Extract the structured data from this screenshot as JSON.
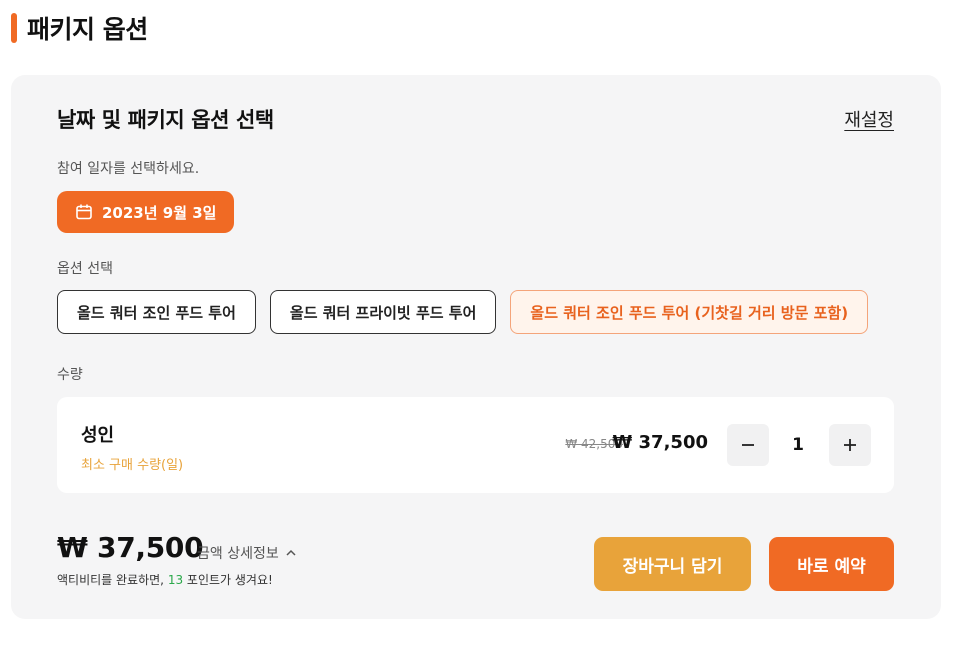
{
  "header": {
    "title": "패키지 옵션",
    "accent_color": "#f06a24"
  },
  "panel": {
    "title": "날짜 및 패키지 옵션 선택",
    "reset_label": "재설정",
    "date_prompt": "참여 일자를 선택하세요.",
    "date_value": "2023년 9월 3일",
    "date_icon": "calendar-icon",
    "options_label": "옵션 선택",
    "options": [
      {
        "label": "올드 쿼터 조인 푸드 투어",
        "selected": false
      },
      {
        "label": "올드 쿼터 프라이빗 푸드 투어",
        "selected": false
      },
      {
        "label": "올드 쿼터 조인 푸드 투어 (기찻길 거리 방문 포함)",
        "selected": true
      }
    ],
    "quantity_label": "수량",
    "quantity": {
      "type_label": "성인",
      "min_note": "최소 구매 수량(일)",
      "original_price": "₩ 42,500",
      "price": "₩ 37,500",
      "value": "1",
      "minus_icon": "minus-icon",
      "plus_icon": "plus-icon"
    }
  },
  "footer": {
    "total": "₩ 37,500",
    "detail_label": "금액 상세정보",
    "detail_icon": "chevron-up-icon",
    "points_prefix": "액티비티를 완료하면, ",
    "points_value": "13",
    "points_suffix": " 포인트가 생겨요!",
    "cart_label": "장바구니 담기",
    "book_label": "바로 예약",
    "cart_color": "#e8a33a",
    "book_color": "#f06a24"
  }
}
